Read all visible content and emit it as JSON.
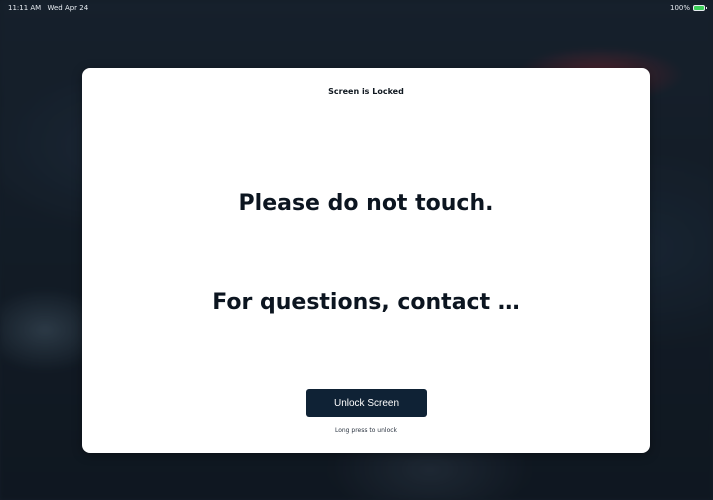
{
  "status_bar": {
    "time": "11:11 AM",
    "date": "Wed Apr 24",
    "battery_percent": "100%",
    "battery_icon": "battery-charging-icon"
  },
  "lock_dialog": {
    "title": "Screen is Locked",
    "message_primary": "Please do not touch.",
    "message_secondary": "For questions, contact …",
    "unlock_button_label": "Unlock Screen",
    "hint": "Long press to unlock"
  },
  "colors": {
    "button_bg": "#0f2235",
    "card_bg": "#ffffff",
    "text_dark": "#0c1520"
  }
}
